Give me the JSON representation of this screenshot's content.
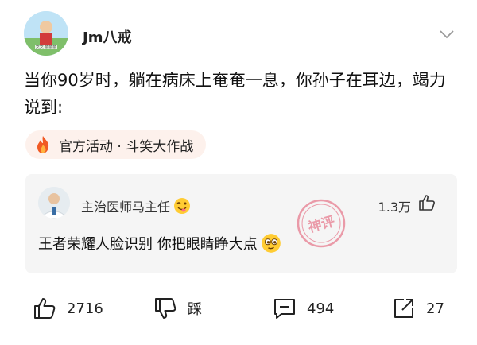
{
  "post": {
    "author": "Jm八戒",
    "text": "当你90岁时，躺在病床上奄奄一息，你孙子在耳边，竭力说到:",
    "avatar_caption": "文文 前前前"
  },
  "tag": {
    "label": "官方活动 · 斗笑大作战",
    "icon": "fire-icon"
  },
  "comment": {
    "author": "主治医师马主任",
    "author_emoji": "tongue-wink-emoji",
    "likes": "1.3万",
    "text": "王者荣耀人脸识别 你把眼睛睁大点",
    "text_emoji": "smirk-face-emoji",
    "stamp_text": "神评"
  },
  "actions": {
    "like_count": "2716",
    "dislike_label": "踩",
    "comment_count": "494",
    "share_count": "27"
  },
  "colors": {
    "tag_bg": "#fdf1ec",
    "comment_bg": "#f5f5f5",
    "stamp": "#e2506b"
  }
}
